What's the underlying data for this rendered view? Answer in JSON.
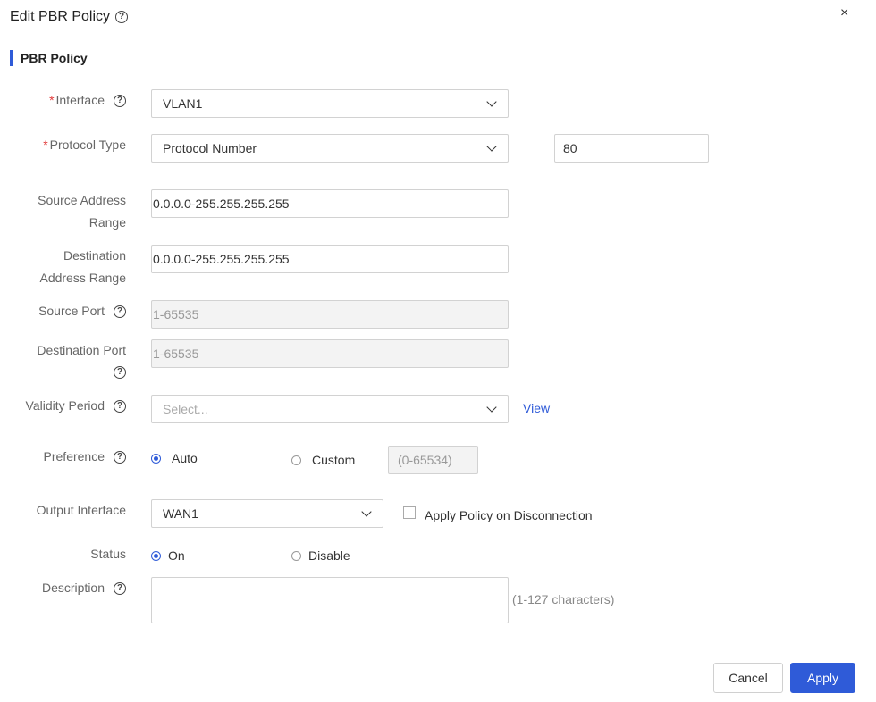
{
  "dialog": {
    "title": "Edit PBR Policy",
    "close_glyph": "×"
  },
  "section": {
    "title": "PBR Policy"
  },
  "form": {
    "interface": {
      "label": "Interface",
      "value": "VLAN1"
    },
    "protocol_type": {
      "label": "Protocol Type",
      "value": "Protocol Number",
      "number_value": "80"
    },
    "source_address": {
      "label_line1": "Source Address",
      "label_line2": "Range",
      "value": "0.0.0.0-255.255.255.255"
    },
    "destination_address": {
      "label_line1": "Destination",
      "label_line2": "Address Range",
      "value": "0.0.0.0-255.255.255.255"
    },
    "source_port": {
      "label": "Source Port",
      "placeholder": "1-65535"
    },
    "destination_port": {
      "label": "Destination Port",
      "placeholder": "1-65535"
    },
    "validity_period": {
      "label": "Validity Period",
      "placeholder": "Select...",
      "view_link": "View"
    },
    "preference": {
      "label": "Preference",
      "option_auto": "Auto",
      "option_custom": "Custom",
      "custom_placeholder": "(0-65534)",
      "selected": "Auto"
    },
    "output_interface": {
      "label": "Output Interface",
      "value": "WAN1",
      "apply_on_disconnection": "Apply Policy on Disconnection"
    },
    "status": {
      "label": "Status",
      "option_on": "On",
      "option_disable": "Disable",
      "selected": "On"
    },
    "description": {
      "label": "Description",
      "hint": "(1-127 characters)"
    }
  },
  "footer": {
    "cancel_label": "Cancel",
    "apply_label": "Apply"
  },
  "colors": {
    "accent": "#2f5bd8",
    "required": "#e23b3b"
  },
  "icons": {
    "help": "help-circle-icon",
    "chevron": "chevron-down-icon",
    "close": "close-icon"
  }
}
